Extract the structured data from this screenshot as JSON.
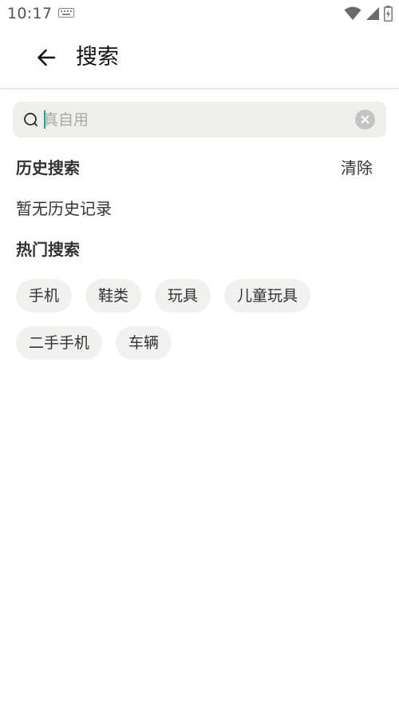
{
  "status_bar": {
    "time": "10:17",
    "icons": [
      "keyboard-icon",
      "wifi-icon",
      "signal-icon",
      "battery-icon"
    ]
  },
  "header": {
    "title": "搜索",
    "back_icon": "arrow-left-icon"
  },
  "search": {
    "placeholder": "真自用",
    "value": "",
    "search_icon": "search-icon",
    "clear_icon": "clear-icon"
  },
  "history": {
    "title": "历史搜索",
    "clear_label": "清除",
    "empty_text": "暂无历史记录"
  },
  "hot": {
    "title": "热门搜索",
    "tags": [
      "手机",
      "鞋类",
      "玩具",
      "儿童玩具",
      "二手手机",
      "车辆"
    ]
  },
  "colors": {
    "accent_caret": "#1aa88a",
    "search_bg": "#efefeb",
    "tag_bg": "#f1f1ef"
  }
}
